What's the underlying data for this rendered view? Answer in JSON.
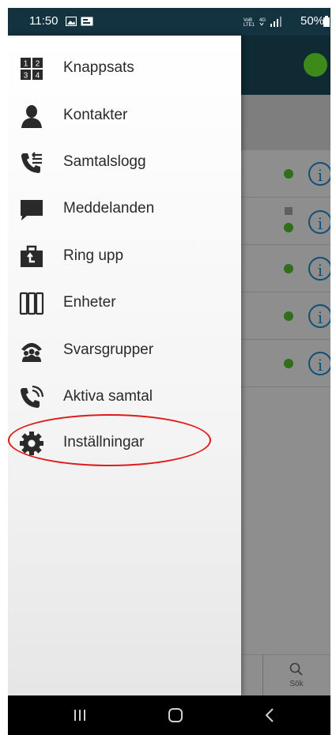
{
  "status_bar": {
    "time": "11:50",
    "battery": "50%",
    "network_text": "4G",
    "volte_text": "LTE1"
  },
  "drawer": {
    "items": [
      {
        "label": "Knappsats",
        "icon": "keypad-icon"
      },
      {
        "label": "Kontakter",
        "icon": "contact-person-icon"
      },
      {
        "label": "Samtalslogg",
        "icon": "call-log-icon"
      },
      {
        "label": "Meddelanden",
        "icon": "chat-bubble-icon"
      },
      {
        "label": "Ring upp",
        "icon": "callback-bag-icon"
      },
      {
        "label": "Enheter",
        "icon": "devices-icon"
      },
      {
        "label": "Svarsgrupper",
        "icon": "answer-groups-icon"
      },
      {
        "label": "Aktiva samtal",
        "icon": "active-call-icon"
      },
      {
        "label": "Inställningar",
        "icon": "gear-icon"
      }
    ]
  },
  "background_app": {
    "bottom_tab_label": "Sök",
    "presence_color": "#3d8a1a",
    "info_icon_color": "#0f4f7a"
  },
  "annotation": {
    "color": "#e01a1a",
    "highlighted_item": "Inställningar"
  }
}
